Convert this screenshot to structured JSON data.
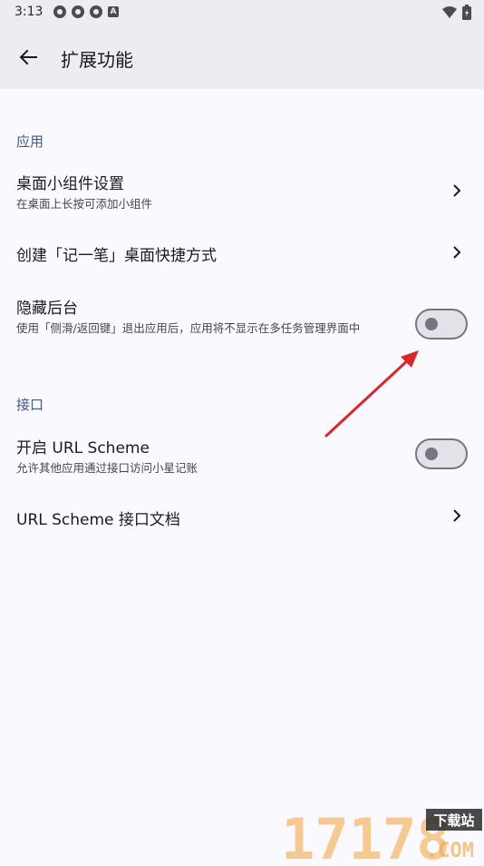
{
  "status_bar": {
    "time": "3:13"
  },
  "header": {
    "title": "扩展功能"
  },
  "sections": [
    {
      "header": "应用",
      "items": [
        {
          "title": "桌面小组件设置",
          "subtitle": "在桌面上长按可添加小组件"
        },
        {
          "title": "创建「记一笔」桌面快捷方式"
        },
        {
          "title": "隐藏后台",
          "subtitle": "使用「侧滑/返回键」退出应用后，应用将不显示在多任务管理界面中",
          "toggle_on": false
        }
      ]
    },
    {
      "header": "接口",
      "items": [
        {
          "title": "开启 URL Scheme",
          "subtitle": "允许其他应用通过接口访问小星记账",
          "toggle_on": false
        },
        {
          "title": "URL Scheme 接口文档"
        }
      ]
    }
  ],
  "watermark": {
    "number": "17178",
    "tag": "下载站",
    "domain": ".COM"
  },
  "colors": {
    "accent": "#3e5a8c",
    "annotation_arrow": "#d8282a",
    "watermark_orange": "#f4a23a"
  },
  "icons": [
    "back-arrow-icon",
    "chevron-right-icon",
    "wifi-icon",
    "battery-icon"
  ]
}
